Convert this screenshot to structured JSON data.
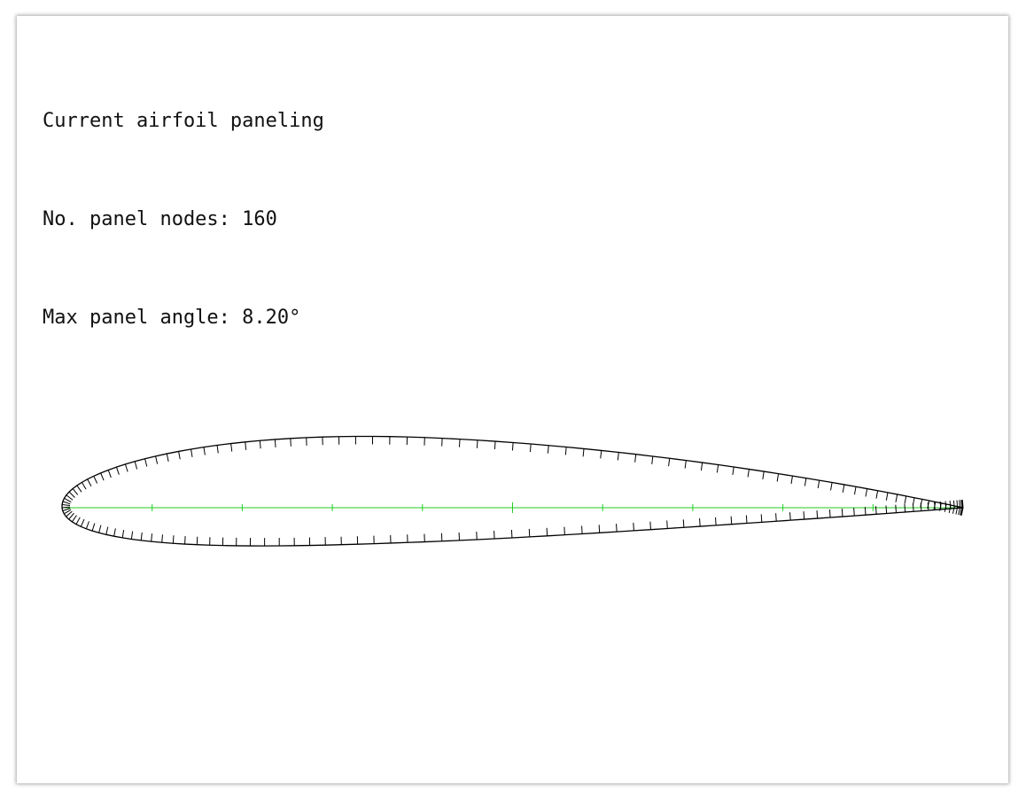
{
  "plot": {
    "title": "Current airfoil paneling",
    "nodes_line": "No. panel nodes: 160",
    "angle_line": "Max panel angle: 8.20°"
  },
  "airfoil": {
    "panel_nodes": 160,
    "max_panel_angle_deg": 8.2,
    "max_thickness_fraction": 0.12,
    "max_camber_fraction": 0.02,
    "max_camber_position": 0.4
  },
  "colors": {
    "outline": "#000000",
    "camber_line": "#22cc22",
    "background": "#ffffff"
  }
}
